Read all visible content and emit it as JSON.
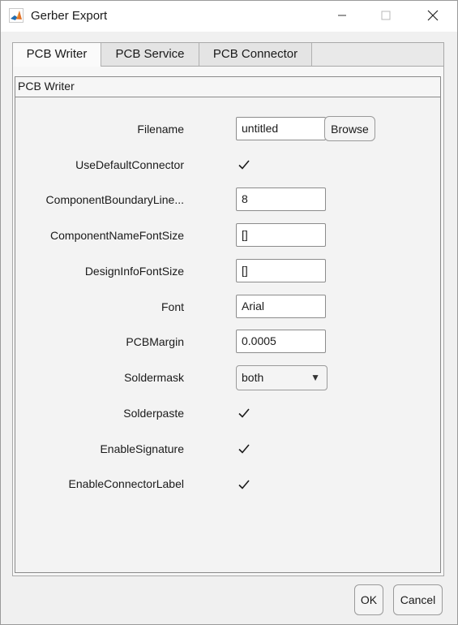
{
  "window": {
    "title": "Gerber Export",
    "app_icon": "matlab-icon",
    "controls": {
      "minimize": "minimize-icon",
      "maximize": "maximize-icon",
      "close": "close-icon"
    }
  },
  "tabs": [
    {
      "label": "PCB Writer",
      "active": true
    },
    {
      "label": "PCB Service",
      "active": false
    },
    {
      "label": "PCB Connector",
      "active": false
    }
  ],
  "panel": {
    "title": "PCB Writer",
    "filename": {
      "label": "Filename",
      "value": "untitled",
      "browse_label": "Browse"
    },
    "use_default_connector": {
      "label": "UseDefaultConnector",
      "checked": true
    },
    "component_boundary_line": {
      "label": "ComponentBoundaryLine...",
      "value": "8"
    },
    "component_name_font_size": {
      "label": "ComponentNameFontSize",
      "value": "[]"
    },
    "design_info_font_size": {
      "label": "DesignInfoFontSize",
      "value": "[]"
    },
    "font": {
      "label": "Font",
      "value": "Arial"
    },
    "pcb_margin": {
      "label": "PCBMargin",
      "value": "0.0005"
    },
    "soldermask": {
      "label": "Soldermask",
      "value": "both"
    },
    "solderpaste": {
      "label": "Solderpaste",
      "checked": true
    },
    "enable_signature": {
      "label": "EnableSignature",
      "checked": true
    },
    "enable_connector_label": {
      "label": "EnableConnectorLabel",
      "checked": true
    }
  },
  "footer": {
    "ok_label": "OK",
    "cancel_label": "Cancel"
  }
}
